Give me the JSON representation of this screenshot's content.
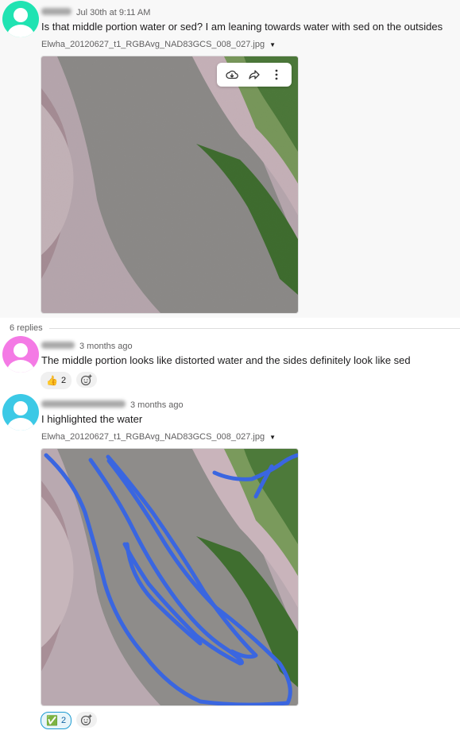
{
  "messages": [
    {
      "timestamp": "Jul 30th at 9:11 AM",
      "text": "Is that middle portion water or sed? I am leaning towards water with sed on the outsides",
      "attachment": "Elwha_20120627_t1_RGBAvg_NAD83GCS_008_027.jpg",
      "avatar_color": "#20e3b2"
    }
  ],
  "thread": {
    "reply_count_label": "6 replies"
  },
  "replies": [
    {
      "timestamp": "3 months ago",
      "text": "The middle portion looks like distorted water and the sides definitely look like sed",
      "avatar_color": "#f47ae5",
      "reaction": {
        "emoji": "👍",
        "count": "2"
      }
    },
    {
      "timestamp": "3 months ago",
      "text": "I highlighted the water",
      "attachment": "Elwha_20120627_t1_RGBAvg_NAD83GCS_008_027.jpg",
      "avatar_color": "#3cc9e6",
      "reaction": {
        "emoji": "✅",
        "count": "2"
      }
    }
  ],
  "icons": {
    "download": "download-icon",
    "share": "share-icon",
    "more": "more-icon",
    "add_reaction": "add-reaction-icon",
    "dropdown": "chevron-down-icon"
  },
  "colors": {
    "highlight_stroke": "#3a66e0",
    "reaction_active_border": "#1d9bd1"
  }
}
